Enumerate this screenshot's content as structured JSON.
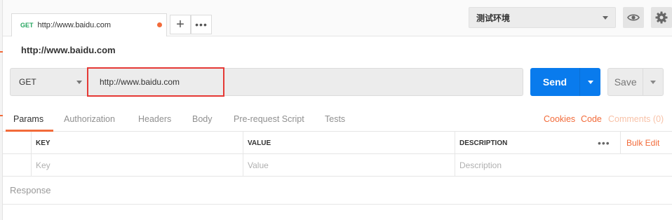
{
  "tab": {
    "method": "GET",
    "title": "http://www.baidu.com"
  },
  "tab_actions": {
    "add_label": "+",
    "more_label": "•••"
  },
  "environment": {
    "selected": "测试环境"
  },
  "request": {
    "name": "http://www.baidu.com",
    "method": "GET",
    "url": "http://www.baidu.com"
  },
  "buttons": {
    "send": "Send",
    "save": "Save"
  },
  "subtabs": [
    "Params",
    "Authorization",
    "Headers",
    "Body",
    "Pre-request Script",
    "Tests"
  ],
  "links": {
    "cookies": "Cookies",
    "code": "Code",
    "comments": "Comments (0)"
  },
  "params_table": {
    "headers": {
      "key": "KEY",
      "value": "VALUE",
      "description": "DESCRIPTION"
    },
    "more": "•••",
    "bulk_edit": "Bulk Edit",
    "placeholders": {
      "key": "Key",
      "value": "Value",
      "description": "Description"
    }
  },
  "response_label": "Response",
  "colors": {
    "accent": "#f26b3a",
    "send": "#097bed",
    "highlight": "#e53935",
    "get_method": "#27a660"
  }
}
